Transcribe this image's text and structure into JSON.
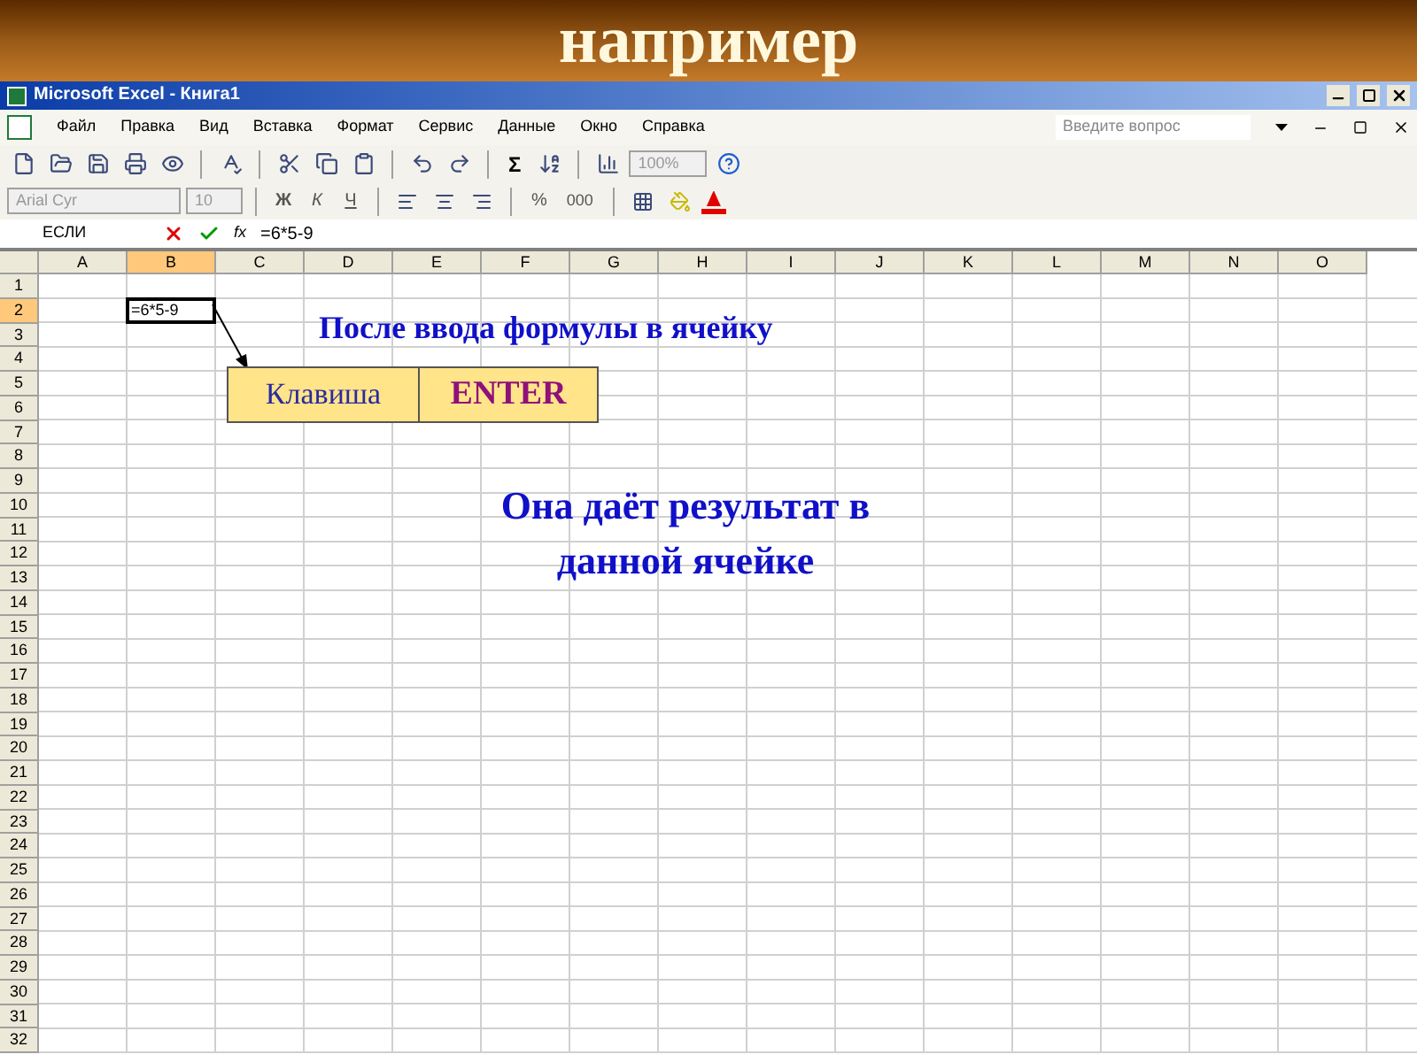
{
  "slide_title": "например",
  "window": {
    "title": "Microsoft Excel - Книга1"
  },
  "menu": [
    "Файл",
    "Правка",
    "Вид",
    "Вставка",
    "Формат",
    "Сервис",
    "Данные",
    "Окно",
    "Справка"
  ],
  "help_box": {
    "placeholder": "Введите вопрос"
  },
  "toolbar": {
    "sum": "Σ",
    "zoom": "100%"
  },
  "format_toolbar": {
    "font": "Arial Cyr",
    "size": "10",
    "styles": [
      "Ж",
      "К",
      "Ч"
    ],
    "percent": "%",
    "thousands": "000"
  },
  "formula_bar": {
    "name_box": "ЕСЛИ",
    "fx": "fx",
    "formula": "=6*5-9"
  },
  "columns": [
    {
      "label": "A",
      "selected": false
    },
    {
      "label": "B",
      "selected": true
    },
    {
      "label": "C",
      "selected": false
    },
    {
      "label": "D",
      "selected": false
    },
    {
      "label": "E",
      "selected": false
    },
    {
      "label": "F",
      "selected": false
    },
    {
      "label": "G",
      "selected": false
    },
    {
      "label": "H",
      "selected": false
    },
    {
      "label": "I",
      "selected": false
    },
    {
      "label": "J",
      "selected": false
    },
    {
      "label": "K",
      "selected": false
    },
    {
      "label": "L",
      "selected": false
    },
    {
      "label": "M",
      "selected": false
    },
    {
      "label": "N",
      "selected": false
    },
    {
      "label": "O",
      "selected": false
    }
  ],
  "rows": [
    {
      "label": "1",
      "selected": false
    },
    {
      "label": "2",
      "selected": true
    },
    {
      "label": "3",
      "selected": false
    },
    {
      "label": "4",
      "selected": false
    },
    {
      "label": "5",
      "selected": false
    },
    {
      "label": "6",
      "selected": false
    },
    {
      "label": "7",
      "selected": false
    },
    {
      "label": "8",
      "selected": false
    },
    {
      "label": "9",
      "selected": false
    },
    {
      "label": "10",
      "selected": false
    },
    {
      "label": "11",
      "selected": false
    },
    {
      "label": "12",
      "selected": false
    },
    {
      "label": "13",
      "selected": false
    },
    {
      "label": "14",
      "selected": false
    },
    {
      "label": "15",
      "selected": false
    },
    {
      "label": "16",
      "selected": false
    },
    {
      "label": "17",
      "selected": false
    },
    {
      "label": "18",
      "selected": false
    },
    {
      "label": "19",
      "selected": false
    },
    {
      "label": "20",
      "selected": false
    },
    {
      "label": "21",
      "selected": false
    },
    {
      "label": "22",
      "selected": false
    },
    {
      "label": "23",
      "selected": false
    },
    {
      "label": "24",
      "selected": false
    },
    {
      "label": "25",
      "selected": false
    },
    {
      "label": "26",
      "selected": false
    },
    {
      "label": "27",
      "selected": false
    },
    {
      "label": "28",
      "selected": false
    },
    {
      "label": "29",
      "selected": false
    },
    {
      "label": "30",
      "selected": false
    },
    {
      "label": "31",
      "selected": false
    },
    {
      "label": "32",
      "selected": false
    }
  ],
  "active_cell": {
    "value": "=6*5-9"
  },
  "caption": "После ввода формулы в ячейку",
  "key_box": {
    "label": "Клавиша",
    "key": "ENTER"
  },
  "result_text": "Она даёт результат в данной ячейке"
}
